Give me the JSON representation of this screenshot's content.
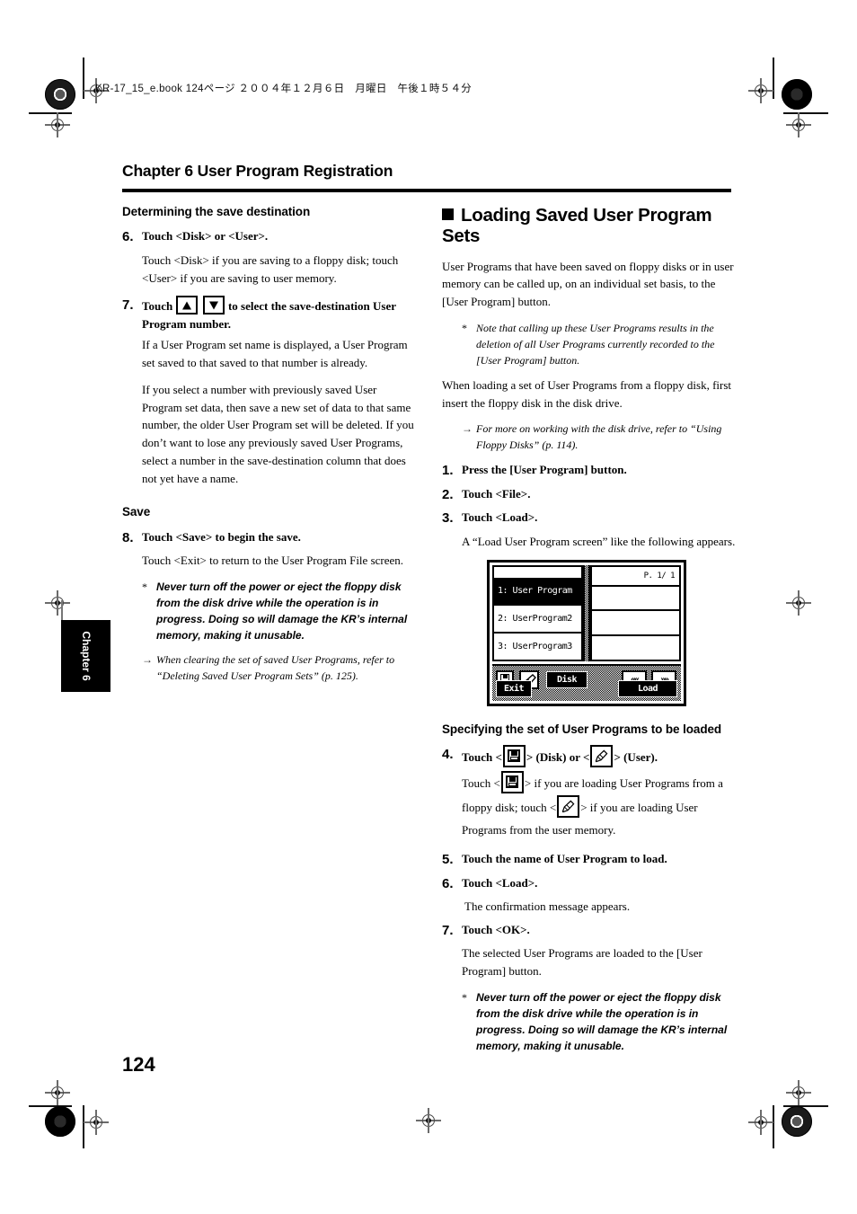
{
  "slug": "KR-17_15_e.book  124ページ  ２００４年１２月６日　月曜日　午後１時５４分",
  "chapter": {
    "title": "Chapter 6 User Program Registration",
    "side_tab": "Chapter 6"
  },
  "page_number": "124",
  "left_column": {
    "heading_save_destination": "Determining the save destination",
    "step6": {
      "num": "6.",
      "text": "Touch <Disk> or <User>.",
      "body": "Touch <Disk> if you are saving to a floppy disk; touch <User> if you are saving to user memory."
    },
    "step7": {
      "num": "7.",
      "text_before": "Touch",
      "text_after": "to select the save-destination User Program number.",
      "body1": "If a User Program set name is displayed, a User Program set saved to that saved to that number is already.",
      "body2": "If you select a number with previously saved User Program set data, then save a new set of data to that same number, the older User Program set will be deleted. If you don’t want to lose any previously saved User Programs, select a number in the save-destination column that does not yet have a name."
    },
    "heading_save": "Save",
    "step8": {
      "num": "8.",
      "text": "Touch <Save> to begin the save.",
      "body": "Touch <Exit> to return to the User Program File screen."
    },
    "warning": {
      "marker": "*",
      "text": "Never turn off the power or eject the floppy disk from the disk drive while the operation is in progress. Doing so will damage the KR’s internal memory, making it unusable."
    },
    "refnote": {
      "marker": "→",
      "text": "When clearing the set of saved User Programs, refer to “Deleting Saved User Program Sets” (p. 125)."
    }
  },
  "right_column": {
    "heading": "Loading Saved User Program Sets",
    "intro": "User Programs that have been saved on floppy disks or in user memory can be called up, on an individual set basis, to the [User Program] button.",
    "note1": {
      "marker": "*",
      "text": "Note that calling up these User Programs results in the deletion of all User Programs currently recorded to the [User Program] button."
    },
    "body2": "When loading a set of User Programs from a floppy disk, first insert the floppy disk in the disk drive.",
    "note2": {
      "marker": "→",
      "text": "For more on working with the disk drive, refer to “Using Floppy Disks” (p. 114)."
    },
    "step1": {
      "num": "1.",
      "text": "Press the [User Program] button."
    },
    "step2": {
      "num": "2.",
      "text": "Touch <File>."
    },
    "step3": {
      "num": "3.",
      "text": "Touch <Load>.",
      "body": "A “Load User Program screen” like the following appears."
    },
    "heading_specifying": "Specifying the set of User Programs to be loaded",
    "step4": {
      "num": "4.",
      "text_a": "Touch <",
      "text_b": "> (Disk) or <",
      "text_c": "> (User).",
      "body_a": "Touch <",
      "body_b": "> if you are loading User Programs from a floppy disk; touch <",
      "body_c": "> if you are loading User Programs from the user memory."
    },
    "step5": {
      "num": "5.",
      "text": "Touch the name of User Program to load."
    },
    "step6": {
      "num": "6.",
      "text": "Touch <Load>.",
      "body": "The confirmation message appears."
    },
    "step7": {
      "num": "7.",
      "text": "Touch <OK>.",
      "body": "The selected User Programs are loaded to the [User Program] button."
    },
    "warning": {
      "marker": "*",
      "text": "Never turn off the power or eject the floppy disk from the disk drive while the operation is in progress. Doing so will damage the KR’s internal memory, making it unusable."
    }
  },
  "lcd_screen": {
    "page_indicator": "P. 1/ 1",
    "list": [
      {
        "label": "1: User Program",
        "selected": true
      },
      {
        "label": "2: UserProgram2",
        "selected": false
      },
      {
        "label": "3: UserProgram3",
        "selected": false
      }
    ],
    "disk_button": "Disk",
    "exit_button": "Exit",
    "load_button": "Load",
    "prev_button": "««",
    "next_button": "»»",
    "floppy_icon": "floppy-disk-icon",
    "pencil_icon": "pencil-user-memory-icon"
  },
  "colors": {
    "ink": "#000000",
    "paper": "#ffffff",
    "regmark": "#6b6b6b"
  }
}
